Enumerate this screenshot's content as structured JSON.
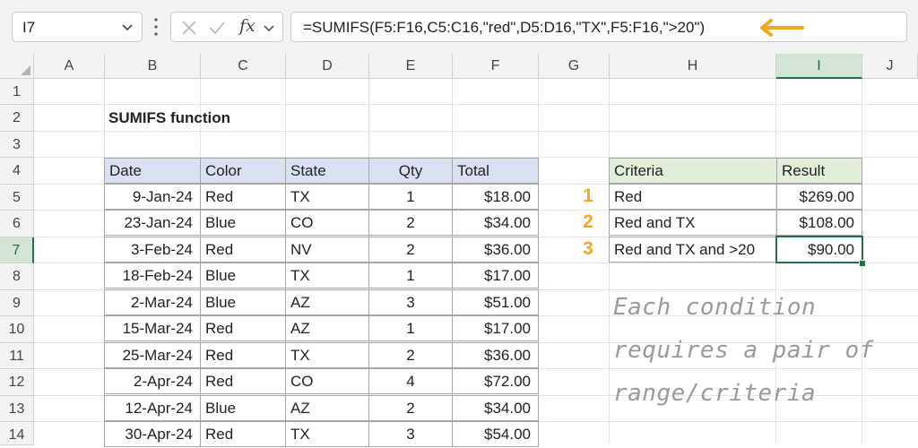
{
  "name_box": {
    "value": "I7"
  },
  "formula_bar": {
    "fx_label": "fx",
    "formula": "=SUMIFS(F5:F16,C5:C16,\"red\",D5:D16,\"TX\",F5:F16,\">20\")"
  },
  "columns": [
    "A",
    "B",
    "C",
    "D",
    "E",
    "F",
    "G",
    "H",
    "I",
    "J"
  ],
  "rows": [
    "1",
    "2",
    "3",
    "4",
    "5",
    "6",
    "7",
    "8",
    "9",
    "10",
    "11",
    "12",
    "13",
    "14"
  ],
  "selected": {
    "column": "I",
    "row": "7"
  },
  "sheet": {
    "title": "SUMIFS function",
    "table": {
      "headers": {
        "date": "Date",
        "color": "Color",
        "state": "State",
        "qty": "Qty",
        "total": "Total"
      },
      "rows": [
        {
          "date": "9-Jan-24",
          "color": "Red",
          "state": "TX",
          "qty": "1",
          "total": "$18.00"
        },
        {
          "date": "23-Jan-24",
          "color": "Blue",
          "state": "CO",
          "qty": "2",
          "total": "$34.00"
        },
        {
          "date": "3-Feb-24",
          "color": "Red",
          "state": "NV",
          "qty": "2",
          "total": "$36.00"
        },
        {
          "date": "18-Feb-24",
          "color": "Blue",
          "state": "TX",
          "qty": "1",
          "total": "$17.00"
        },
        {
          "date": "2-Mar-24",
          "color": "Blue",
          "state": "AZ",
          "qty": "3",
          "total": "$51.00"
        },
        {
          "date": "15-Mar-24",
          "color": "Red",
          "state": "AZ",
          "qty": "1",
          "total": "$17.00"
        },
        {
          "date": "25-Mar-24",
          "color": "Red",
          "state": "TX",
          "qty": "2",
          "total": "$36.00"
        },
        {
          "date": "2-Apr-24",
          "color": "Red",
          "state": "CO",
          "qty": "4",
          "total": "$72.00"
        },
        {
          "date": "12-Apr-24",
          "color": "Blue",
          "state": "AZ",
          "qty": "2",
          "total": "$34.00"
        },
        {
          "date": "30-Apr-24",
          "color": "Red",
          "state": "TX",
          "qty": "3",
          "total": "$54.00"
        }
      ]
    },
    "criteria_table": {
      "headers": {
        "criteria": "Criteria",
        "result": "Result"
      },
      "rows": [
        {
          "num": "1",
          "criteria": "Red",
          "result": "$269.00"
        },
        {
          "num": "2",
          "criteria": "Red and TX",
          "result": "$108.00"
        },
        {
          "num": "3",
          "criteria": "Red and TX and >20",
          "result": "$90.00"
        }
      ]
    },
    "note": [
      "Each condition",
      "requires a pair of",
      "range/criteria"
    ]
  },
  "colors": {
    "accent_green": "#1e7145",
    "arrow_orange": "#f5a623",
    "table_header_blue": "#d9e1f2",
    "criteria_header_green": "#e2efda"
  },
  "icons": [
    "chevron-down-icon",
    "more-options-icon",
    "cancel-x-icon",
    "confirm-check-icon",
    "fx-icon",
    "arrow-left-icon",
    "select-all-icon"
  ]
}
